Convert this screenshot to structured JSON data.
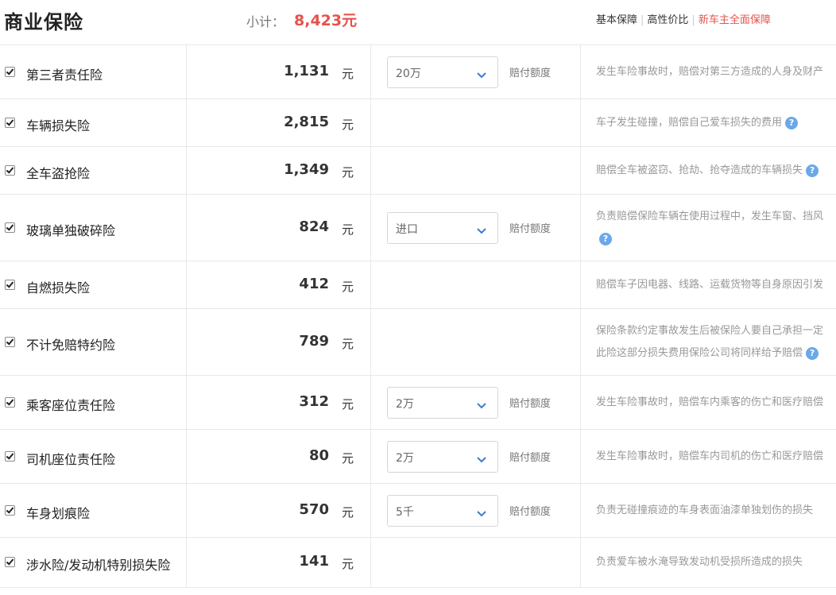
{
  "header": {
    "title": "商业保险",
    "subtotal_label": "小计：",
    "subtotal_value": "8,423元",
    "plans": [
      {
        "label": "基本保障",
        "active": false
      },
      {
        "label": "高性价比",
        "active": false
      },
      {
        "label": "新车主全面保障",
        "active": true
      }
    ]
  },
  "unit": "元",
  "coverage_label": "赔付额度",
  "help_glyph": "?",
  "items": [
    {
      "name": "第三者责任险",
      "amount": "1,131",
      "checked": true,
      "select": "20万",
      "desc": [
        "发生车险事故时，赔偿对第三方造成的人身及财产"
      ],
      "help": false
    },
    {
      "name": "车辆损失险",
      "amount": "2,815",
      "checked": true,
      "select": null,
      "desc": [
        "车子发生碰撞，赔偿自己爱车损失的费用"
      ],
      "help": true
    },
    {
      "name": "全车盗抢险",
      "amount": "1,349",
      "checked": true,
      "select": null,
      "desc": [
        "赔偿全车被盗窃、抢劫、抢夺造成的车辆损失"
      ],
      "help": true
    },
    {
      "name": "玻璃单独破碎险",
      "amount": "824",
      "checked": true,
      "select": "进口",
      "desc": [
        "负责赔偿保险车辆在使用过程中，发生车窗、挡风",
        ""
      ],
      "help": true
    },
    {
      "name": "自燃损失险",
      "amount": "412",
      "checked": true,
      "select": null,
      "desc": [
        "赔偿车子因电器、线路、运载货物等自身原因引发"
      ],
      "help": false
    },
    {
      "name": "不计免赔特约险",
      "amount": "789",
      "checked": true,
      "select": null,
      "desc": [
        "保险条款约定事故发生后被保险人要自己承担一定",
        "此险这部分损失费用保险公司将同样给予赔偿"
      ],
      "help": true
    },
    {
      "name": "乘客座位责任险",
      "amount": "312",
      "checked": true,
      "select": "2万",
      "desc": [
        "发生车险事故时，赔偿车内乘客的伤亡和医疗赔偿"
      ],
      "help": false
    },
    {
      "name": "司机座位责任险",
      "amount": "80",
      "checked": true,
      "select": "2万",
      "desc": [
        "发生车险事故时，赔偿车内司机的伤亡和医疗赔偿"
      ],
      "help": false
    },
    {
      "name": "车身划痕险",
      "amount": "570",
      "checked": true,
      "select": "5千",
      "desc": [
        "负责无碰撞痕迹的车身表面油漆单独划伤的损失"
      ],
      "help": false
    },
    {
      "name": "涉水险/发动机特别损失险",
      "amount": "141",
      "checked": true,
      "select": null,
      "desc": [
        "负责爱车被水淹导致发动机受损所造成的损失"
      ],
      "help": false
    }
  ],
  "colors": {
    "accent": "#e5534b",
    "help": "#6aa8e8",
    "border": "#e8e8e8"
  }
}
